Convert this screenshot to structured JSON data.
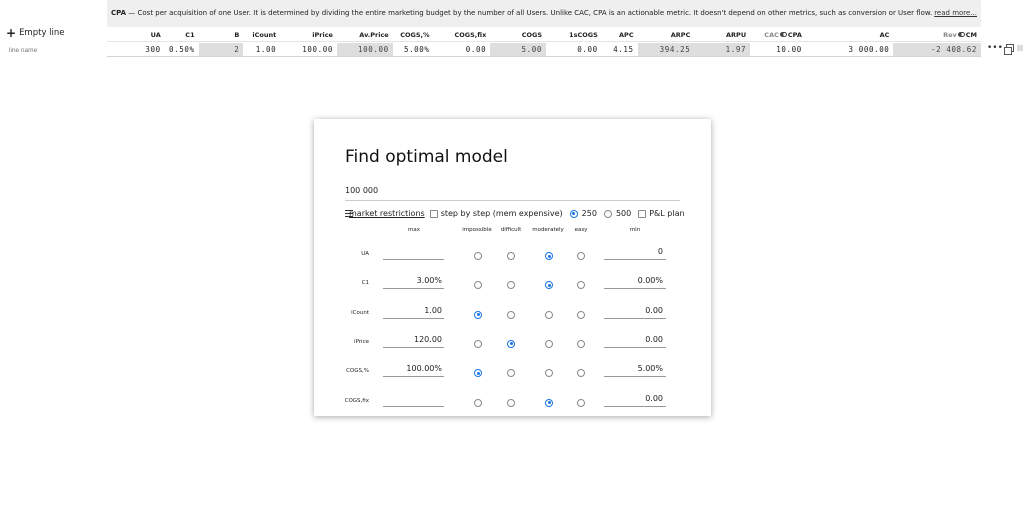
{
  "banner": {
    "term": "CPA",
    "text": " — Cost per acquisition of one User. It is determined by dividing the entire marketing budget by the number of all Users. Unlike CAC, CPA is an actionable metric. It doesn't depend on other metrics, such as conversion or User flow.",
    "read_more": "read more..."
  },
  "controls": {
    "add_line_label": "Empty line",
    "line_name_placeholder": "line name"
  },
  "metrics": {
    "headers": [
      "UA",
      "C1",
      "B",
      "iCount",
      "iPrice",
      "Av.Price",
      "COGS,%",
      "COGS,fix",
      "COGS",
      "1sCOGS",
      "APC",
      "ARPC",
      "ARPU",
      "CAC",
      "CPA",
      "AC",
      "Rev",
      "CM"
    ],
    "values": [
      "300",
      "0.50%",
      "2",
      "1.00",
      "100.00",
      "100.00",
      "5.00%",
      "0.00",
      "5.00",
      "0.00",
      "4.15",
      "394.25",
      "1.97",
      "10.00",
      "3 000.00",
      "-2 408.62"
    ]
  },
  "modal": {
    "title": "Find optimal model",
    "budget_value": "100 000",
    "market_restrictions": "market restrictions",
    "step_by_step": "step by step (mem expensive)",
    "opt_250": "250",
    "opt_500": "500",
    "pl_plan": "P&L plan",
    "columns": {
      "max": "max",
      "impossible": "impossible",
      "difficult": "difficult",
      "moderately": "moderately",
      "easy": "easy",
      "min": "min"
    },
    "rows": [
      {
        "label": "UA",
        "max": "",
        "min": "0",
        "selected": 2
      },
      {
        "label": "C1",
        "max": "3.00%",
        "min": "0.00%",
        "selected": 2
      },
      {
        "label": "iCount",
        "max": "1.00",
        "min": "0.00",
        "selected": 0
      },
      {
        "label": "iPrice",
        "max": "120.00",
        "min": "0.00",
        "selected": 1
      },
      {
        "label": "COGS,%",
        "max": "100.00%",
        "min": "5.00%",
        "selected": 0
      },
      {
        "label": "COGS,fix",
        "max": "",
        "min": "0.00",
        "selected": 2
      }
    ]
  },
  "colors": {
    "accent": "#1a73e8",
    "banner_bg": "#efefef",
    "grey_cell": "#dedede"
  }
}
